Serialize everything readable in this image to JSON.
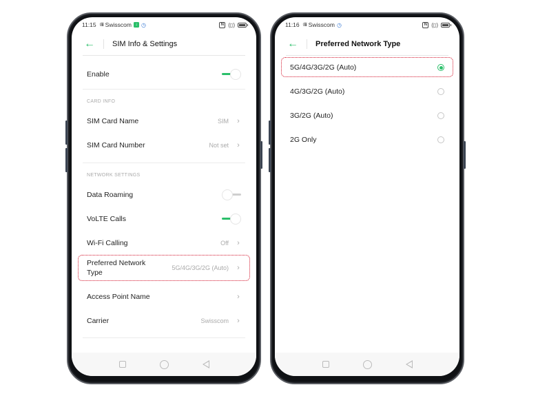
{
  "left_phone": {
    "status_bar": {
      "time": "11:15",
      "signal": "4G",
      "carrier": "Swisscom",
      "badges": [
        "green-notification-icon",
        "blue-sync-icon"
      ],
      "right_icons": [
        "nfc-icon",
        "vibrate-icon",
        "battery-icon"
      ]
    },
    "app_bar": {
      "back_icon": "arrow-left-icon",
      "title": "SIM Info & Settings"
    },
    "enable": {
      "label": "Enable",
      "toggle_on": true
    },
    "card_info": {
      "header": "CARD INFO",
      "items": [
        {
          "label": "SIM Card Name",
          "value": "SIM"
        },
        {
          "label": "SIM Card Number",
          "value": "Not set"
        }
      ]
    },
    "network_settings": {
      "header": "NETWORK SETTINGS",
      "data_roaming": {
        "label": "Data Roaming",
        "toggle_on": false
      },
      "volte": {
        "label": "VoLTE Calls",
        "toggle_on": true
      },
      "wifi_calling": {
        "label": "Wi-Fi Calling",
        "value": "Off"
      },
      "preferred_network": {
        "label_line1": "Preferred Network",
        "label_line2": "Type",
        "value": "5G/4G/3G/2G (Auto)",
        "highlighted": true
      },
      "apn": {
        "label": "Access Point Name",
        "value": ""
      },
      "carrier": {
        "label": "Carrier",
        "value": "Swisscom"
      }
    },
    "nav_bar": [
      "recents-icon",
      "home-icon",
      "back-icon"
    ]
  },
  "right_phone": {
    "status_bar": {
      "time": "11:16",
      "signal": "4G",
      "carrier": "Swisscom",
      "badges": [
        "blue-sync-icon"
      ],
      "right_icons": [
        "nfc-icon",
        "vibrate-icon",
        "battery-icon"
      ]
    },
    "app_bar": {
      "back_icon": "arrow-left-icon",
      "title": "Preferred Network Type"
    },
    "options": [
      {
        "label": "5G/4G/3G/2G (Auto)",
        "selected": true,
        "highlighted": true
      },
      {
        "label": "4G/3G/2G (Auto)",
        "selected": false
      },
      {
        "label": "3G/2G (Auto)",
        "selected": false
      },
      {
        "label": "2G Only",
        "selected": false
      }
    ],
    "nav_bar": [
      "recents-icon",
      "home-icon",
      "back-icon"
    ]
  },
  "glyphs": {
    "back_arrow": "←",
    "chevron": "›",
    "signal": "ᵍ‖ıl",
    "nfc": "N",
    "vibrate": "(▯)",
    "green_badge": "↓",
    "blue_badge": "◷"
  },
  "colors": {
    "accent": "#2bbf6a",
    "highlight_border": "#d3142b",
    "secondary_text": "#aaaaaa",
    "primary_text": "#222222"
  }
}
